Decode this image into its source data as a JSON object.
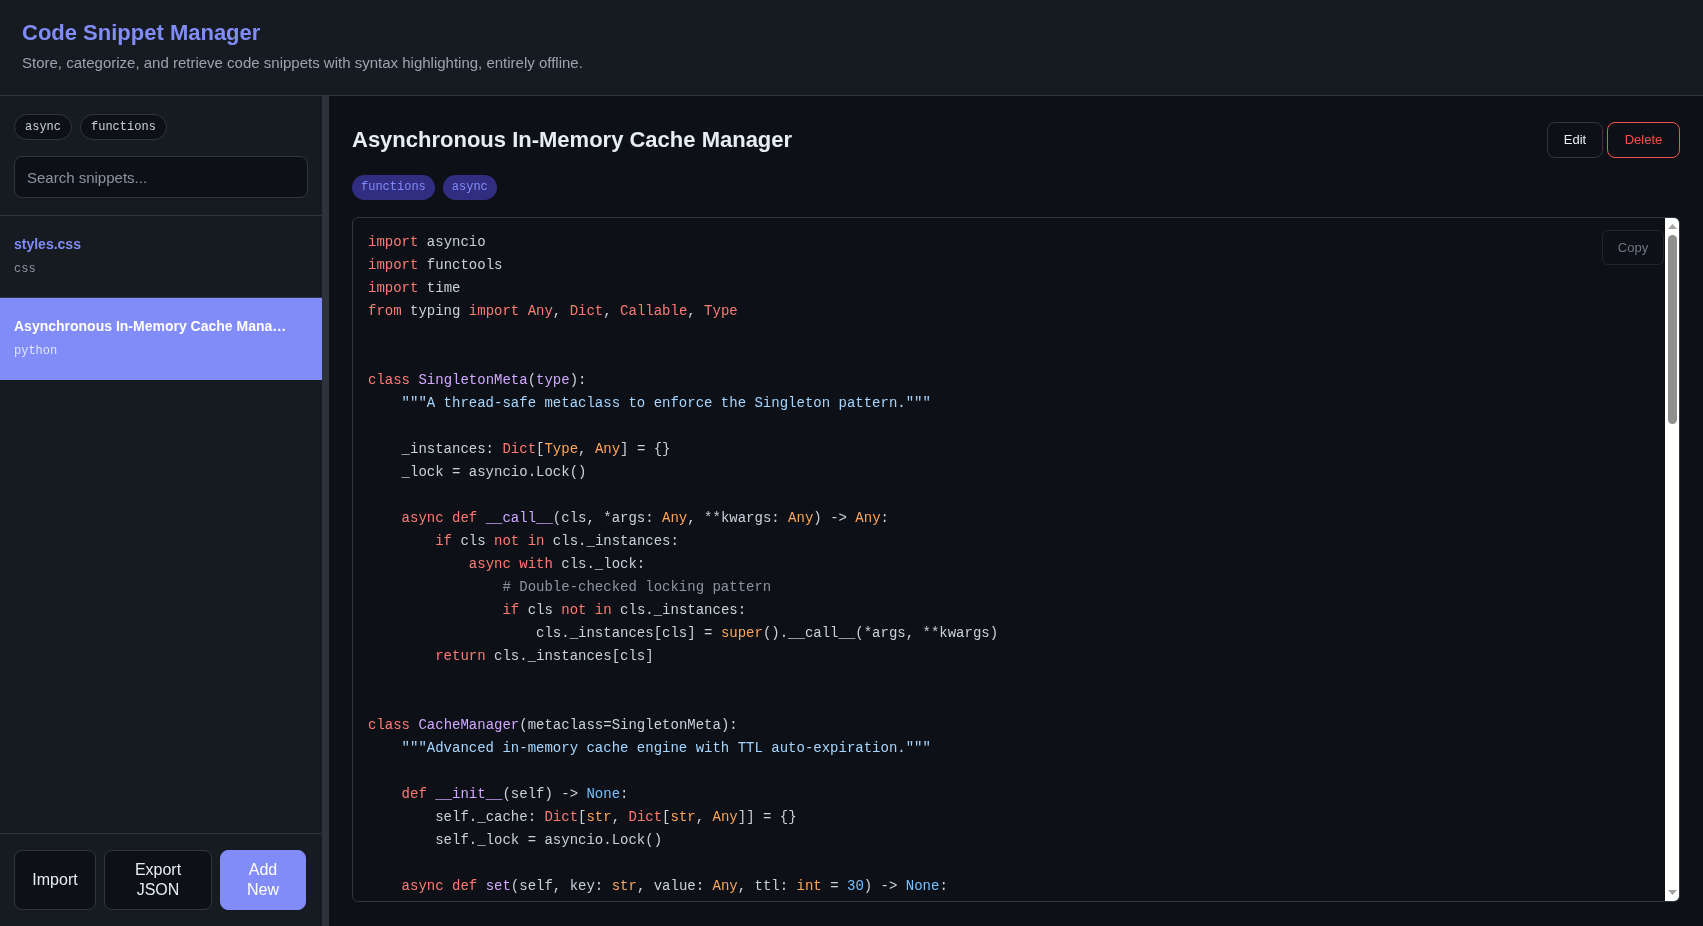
{
  "header": {
    "title": "Code Snippet Manager",
    "subtitle": "Store, categorize, and retrieve code snippets with syntax highlighting, entirely offline."
  },
  "sidebar": {
    "tag_filters": [
      {
        "label": "async",
        "selected": false
      },
      {
        "label": "functions",
        "selected": false
      }
    ],
    "search": {
      "placeholder": "Search snippets..."
    },
    "snippets": [
      {
        "title": "styles.css",
        "language": "css",
        "selected": false
      },
      {
        "title": "Asynchronous In-Memory Cache Mana…",
        "language": "python",
        "selected": true
      }
    ],
    "buttons": [
      {
        "label": "Import",
        "kind": "secondary"
      },
      {
        "label": "Export JSON",
        "kind": "secondary"
      },
      {
        "label": "Add New",
        "kind": "primary"
      }
    ]
  },
  "snippet": {
    "title": "Asynchronous In-Memory Cache Manager",
    "actions": [
      {
        "label": "Edit",
        "kind": "default"
      },
      {
        "label": "Delete",
        "kind": "danger"
      }
    ],
    "tags": [
      "functions",
      "async"
    ],
    "code": {
      "copy_label": "Copy",
      "lines": [
        {
          "kind": "code",
          "tokens": [
            {
              "kind": "keyword",
              "text": "import"
            },
            {
              "kind": "plain",
              "text": " asyncio"
            }
          ]
        },
        {
          "kind": "code",
          "tokens": [
            {
              "kind": "keyword",
              "text": "import"
            },
            {
              "kind": "plain",
              "text": " functools"
            }
          ]
        },
        {
          "kind": "code",
          "tokens": [
            {
              "kind": "keyword",
              "text": "import"
            },
            {
              "kind": "plain",
              "text": " time"
            }
          ]
        },
        {
          "kind": "code",
          "tokens": [
            {
              "kind": "keyword",
              "text": "from "
            },
            {
              "kind": "plain",
              "text": "typing "
            },
            {
              "kind": "keyword",
              "text": "import Any"
            },
            {
              "kind": "plain",
              "text": ", "
            },
            {
              "kind": "keyword",
              "text": "Dict"
            },
            {
              "kind": "plain",
              "text": ", "
            },
            {
              "kind": "keyword",
              "text": "Callable"
            },
            {
              "kind": "plain",
              "text": ", "
            },
            {
              "kind": "keyword",
              "text": "Type"
            }
          ]
        },
        {
          "kind": "blank"
        },
        {
          "kind": "blank"
        },
        {
          "kind": "code",
          "tokens": [
            {
              "kind": "keyword",
              "text": "class "
            },
            {
              "kind": "title",
              "text": "SingletonMeta"
            },
            {
              "kind": "plain",
              "text": "("
            },
            {
              "kind": "title",
              "text": "type"
            },
            {
              "kind": "plain",
              "text": "):"
            }
          ]
        },
        {
          "kind": "code",
          "tokens": [
            {
              "kind": "string",
              "text": "    \"\"\"A thread-safe metaclass to enforce the Singleton pattern.\"\"\""
            }
          ]
        },
        {
          "kind": "blank"
        },
        {
          "kind": "code",
          "tokens": [
            {
              "kind": "plain",
              "text": "    _instances: "
            },
            {
              "kind": "keyword",
              "text": "Dict"
            },
            {
              "kind": "plain",
              "text": "["
            },
            {
              "kind": "builtin",
              "text": "Type"
            },
            {
              "kind": "plain",
              "text": ", "
            },
            {
              "kind": "builtin",
              "text": "Any"
            },
            {
              "kind": "plain",
              "text": "] = {}"
            }
          ]
        },
        {
          "kind": "code",
          "tokens": [
            {
              "kind": "plain",
              "text": "    _lock = asyncio.Lock()"
            }
          ]
        },
        {
          "kind": "blank"
        },
        {
          "kind": "code",
          "tokens": [
            {
              "kind": "keyword",
              "text": "    async def "
            },
            {
              "kind": "title",
              "text": "__call__"
            },
            {
              "kind": "plain",
              "text": "(cls, *args: "
            },
            {
              "kind": "builtin",
              "text": "Any"
            },
            {
              "kind": "plain",
              "text": ", **kwargs: "
            },
            {
              "kind": "builtin",
              "text": "Any"
            },
            {
              "kind": "plain",
              "text": ") -> "
            },
            {
              "kind": "builtin",
              "text": "Any"
            },
            {
              "kind": "plain",
              "text": ":"
            }
          ]
        },
        {
          "kind": "code",
          "tokens": [
            {
              "kind": "keyword",
              "text": "        if"
            },
            {
              "kind": "plain",
              "text": " cls "
            },
            {
              "kind": "keyword",
              "text": "not in"
            },
            {
              "kind": "plain",
              "text": " cls._instances:"
            }
          ]
        },
        {
          "kind": "code",
          "tokens": [
            {
              "kind": "keyword",
              "text": "            async with"
            },
            {
              "kind": "plain",
              "text": " cls._lock:"
            }
          ]
        },
        {
          "kind": "code",
          "tokens": [
            {
              "kind": "comment",
              "text": "                # Double-checked locking pattern"
            }
          ]
        },
        {
          "kind": "code",
          "tokens": [
            {
              "kind": "keyword",
              "text": "                if"
            },
            {
              "kind": "plain",
              "text": " cls "
            },
            {
              "kind": "keyword",
              "text": "not in"
            },
            {
              "kind": "plain",
              "text": " cls._instances:"
            }
          ]
        },
        {
          "kind": "code",
          "tokens": [
            {
              "kind": "plain",
              "text": "                    cls._instances[cls] = "
            },
            {
              "kind": "builtin",
              "text": "super"
            },
            {
              "kind": "plain",
              "text": "().__call__(*args, **kwargs)"
            }
          ]
        },
        {
          "kind": "code",
          "tokens": [
            {
              "kind": "keyword",
              "text": "        return"
            },
            {
              "kind": "plain",
              "text": " cls._instances[cls]"
            }
          ]
        },
        {
          "kind": "blank"
        },
        {
          "kind": "blank"
        },
        {
          "kind": "code",
          "tokens": [
            {
              "kind": "keyword",
              "text": "class "
            },
            {
              "kind": "title",
              "text": "CacheManager"
            },
            {
              "kind": "plain",
              "text": "(metaclass=SingletonMeta):"
            }
          ]
        },
        {
          "kind": "code",
          "tokens": [
            {
              "kind": "string",
              "text": "    \"\"\"Advanced in-memory cache engine with TTL auto-expiration.\"\"\""
            }
          ]
        },
        {
          "kind": "blank"
        },
        {
          "kind": "code",
          "tokens": [
            {
              "kind": "keyword",
              "text": "    def "
            },
            {
              "kind": "title",
              "text": "__init__"
            },
            {
              "kind": "plain",
              "text": "(self) -> "
            },
            {
              "kind": "literal",
              "text": "None"
            },
            {
              "kind": "plain",
              "text": ":"
            }
          ]
        },
        {
          "kind": "code",
          "tokens": [
            {
              "kind": "plain",
              "text": "        self._cache: "
            },
            {
              "kind": "keyword",
              "text": "Dict"
            },
            {
              "kind": "plain",
              "text": "["
            },
            {
              "kind": "builtin",
              "text": "str"
            },
            {
              "kind": "plain",
              "text": ", "
            },
            {
              "kind": "keyword",
              "text": "Dict"
            },
            {
              "kind": "plain",
              "text": "["
            },
            {
              "kind": "builtin",
              "text": "str"
            },
            {
              "kind": "plain",
              "text": ", "
            },
            {
              "kind": "builtin",
              "text": "Any"
            },
            {
              "kind": "plain",
              "text": "]] = {}"
            }
          ]
        },
        {
          "kind": "code",
          "tokens": [
            {
              "kind": "plain",
              "text": "        self._lock = asyncio.Lock()"
            }
          ]
        },
        {
          "kind": "blank"
        },
        {
          "kind": "code",
          "tokens": [
            {
              "kind": "keyword",
              "text": "    async def "
            },
            {
              "kind": "title",
              "text": "set"
            },
            {
              "kind": "plain",
              "text": "(self, key: "
            },
            {
              "kind": "builtin",
              "text": "str"
            },
            {
              "kind": "plain",
              "text": ", value: "
            },
            {
              "kind": "builtin",
              "text": "Any"
            },
            {
              "kind": "plain",
              "text": ", ttl: "
            },
            {
              "kind": "builtin",
              "text": "int"
            },
            {
              "kind": "plain",
              "text": " = "
            },
            {
              "kind": "literal",
              "text": "30"
            },
            {
              "kind": "plain",
              "text": ") -> "
            },
            {
              "kind": "literal",
              "text": "None"
            },
            {
              "kind": "plain",
              "text": ":"
            }
          ]
        }
      ]
    }
  }
}
